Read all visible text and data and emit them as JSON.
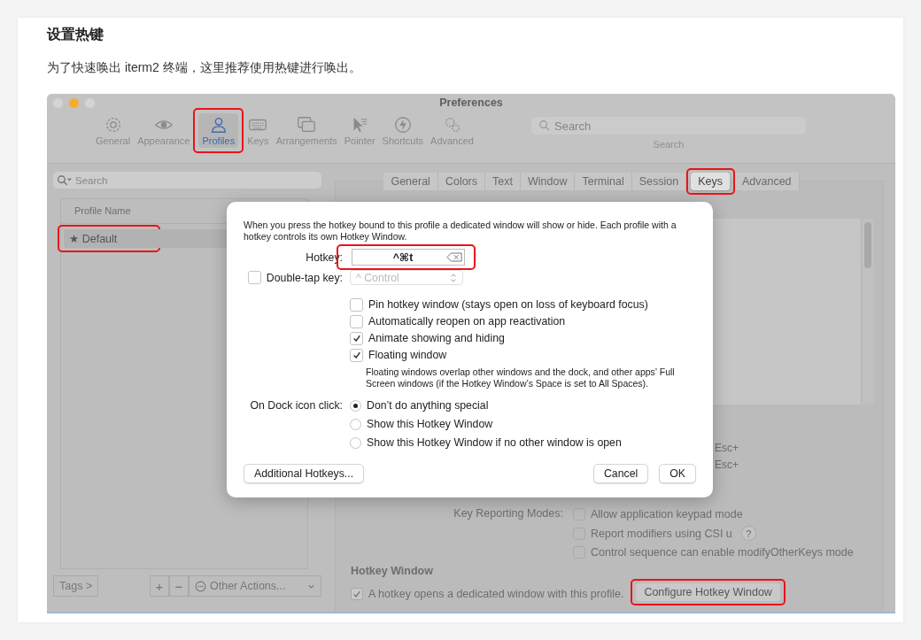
{
  "article": {
    "heading": "设置热键",
    "intro": "为了快速唤出 iterm2 终端，这里推荐使用热键进行唤出。"
  },
  "window": {
    "title": "Preferences",
    "toolbar": [
      {
        "label": "General",
        "selected": false,
        "annotated": false
      },
      {
        "label": "Appearance",
        "selected": false,
        "annotated": false
      },
      {
        "label": "Profiles",
        "selected": true,
        "annotated": true
      },
      {
        "label": "Keys",
        "selected": false,
        "annotated": false
      },
      {
        "label": "Arrangements",
        "selected": false,
        "annotated": false
      },
      {
        "label": "Pointer",
        "selected": false,
        "annotated": false
      },
      {
        "label": "Shortcuts",
        "selected": false,
        "annotated": false
      },
      {
        "label": "Advanced",
        "selected": false,
        "annotated": false
      }
    ],
    "search": {
      "placeholder": "Search",
      "caption": "Search"
    }
  },
  "sidebar": {
    "search": {
      "placeholder": "Search"
    },
    "column": "Profile Name",
    "profiles": [
      {
        "name": "★ Default",
        "selected": true,
        "annotated": true
      }
    ],
    "footer": {
      "tags": "Tags >",
      "add": "+",
      "remove": "−",
      "actions": "Other Actions..."
    }
  },
  "profile_tabs": [
    {
      "label": "General",
      "selected": false,
      "annotated": false
    },
    {
      "label": "Colors",
      "selected": false,
      "annotated": false
    },
    {
      "label": "Text",
      "selected": false,
      "annotated": false
    },
    {
      "label": "Window",
      "selected": false,
      "annotated": false
    },
    {
      "label": "Terminal",
      "selected": false,
      "annotated": false
    },
    {
      "label": "Session",
      "selected": false,
      "annotated": false
    },
    {
      "label": "Keys",
      "selected": true,
      "annotated": true
    },
    {
      "label": "Advanced",
      "selected": false,
      "annotated": false
    }
  ],
  "keys_panel": {
    "esc_labels": [
      "Esc+",
      "Esc+"
    ],
    "reporting_label": "Key Reporting Modes:",
    "reporting_options": [
      {
        "label": "Allow application keypad mode",
        "checked": false
      },
      {
        "label": "Report modifiers using CSI u",
        "checked": false,
        "help": "?"
      },
      {
        "label": "Control sequence can enable modifyOtherKeys mode",
        "checked": false
      }
    ],
    "hotkey_heading": "Hotkey Window",
    "hotkey_checkbox": {
      "label": "A hotkey opens a dedicated window with this profile.",
      "checked": true
    },
    "configure_button": {
      "label": "Configure Hotkey Window",
      "annotated": true
    }
  },
  "dialog": {
    "description": "When you press the hotkey bound to this profile a dedicated window will show or hide. Each profile with a hotkey controls its own Hotkey Window.",
    "hotkey": {
      "label": "Hotkey:",
      "value": "^⌘t",
      "annotated": true
    },
    "double_tap": {
      "label": "Double-tap key:",
      "checked": false,
      "value": "^ Control"
    },
    "options": [
      {
        "label": "Pin hotkey window (stays open on loss of keyboard focus)",
        "checked": false
      },
      {
        "label": "Automatically reopen on app reactivation",
        "checked": false
      },
      {
        "label": "Animate showing and hiding",
        "checked": true
      },
      {
        "label": "Floating window",
        "checked": true,
        "note": "Floating windows overlap other windows and the dock, and other apps’ Full Screen windows (if the Hotkey Window’s Space is set to All Spaces)."
      }
    ],
    "dock_label": "On Dock icon click:",
    "dock_options": [
      {
        "label": "Don’t do anything special",
        "selected": true
      },
      {
        "label": "Show this Hotkey Window",
        "selected": false
      },
      {
        "label": "Show this Hotkey Window if no other window is open",
        "selected": false
      }
    ],
    "additional_button": "Additional Hotkeys...",
    "cancel_button": "Cancel",
    "ok_button": "OK"
  }
}
